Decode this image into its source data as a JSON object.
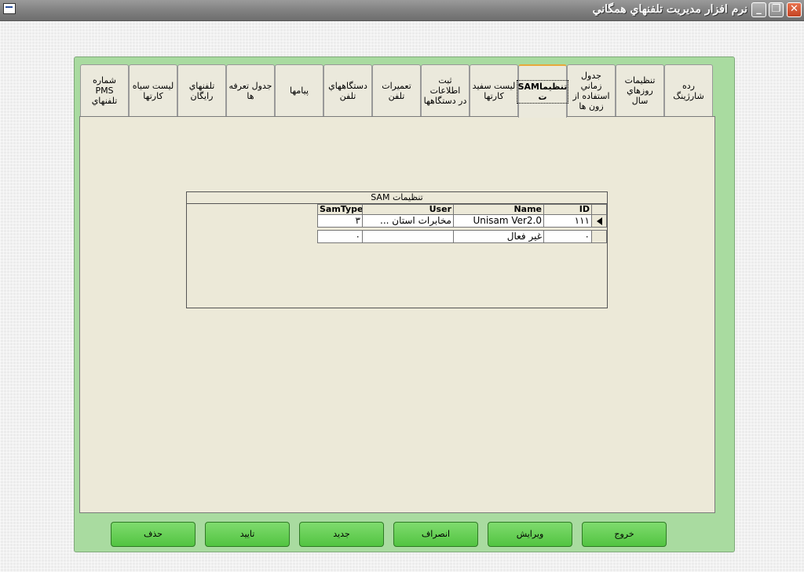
{
  "window": {
    "title": "نرم افزار مديريت تلفنهاي همگاني",
    "min_label": "_",
    "max_label": "❐",
    "close_label": "✕"
  },
  "tabs": [
    {
      "label": "رده شارژينگ",
      "active": false
    },
    {
      "label": "تنظيمات\nروزهاي سال",
      "active": false
    },
    {
      "label": "جدول زماني\nاستفاده از\nزون ها",
      "active": false
    },
    {
      "label": "تنظيماSAM\nت",
      "active": true
    },
    {
      "label": "ليست سفيد\nكارتها",
      "active": false
    },
    {
      "label": "ثبت اطلاعات\nدر دستگاهها",
      "active": false
    },
    {
      "label": "تعميرات\nتلفن",
      "active": false
    },
    {
      "label": "دستگاههاي\nتلفن",
      "active": false
    },
    {
      "label": "پيامها",
      "active": false
    },
    {
      "label": "جدول تعرفه\nها",
      "active": false
    },
    {
      "label": "تلفنهاي\nرايگان",
      "active": false
    },
    {
      "label": "ليست سياه\nكارتها",
      "active": false
    },
    {
      "label": "شماره PMS\nتلفنهاي",
      "active": false
    }
  ],
  "grid": {
    "caption": "تنظيمات SAM",
    "columns": [
      "ID",
      "Name",
      "User",
      "SamType"
    ],
    "rows": [
      {
        "id": "١١١",
        "name": "Unisam Ver2.0",
        "user": "مخابرات استان ...",
        "samtype": "٣",
        "current": true
      },
      {
        "id": "٠",
        "name": "غير فعال",
        "user": "",
        "samtype": "٠",
        "current": false
      }
    ]
  },
  "buttons": {
    "exit": "خروج",
    "edit": "ويرايش",
    "cancel": "انصراف",
    "new": "جديد",
    "confirm": "تاييد",
    "delete": "حذف"
  }
}
